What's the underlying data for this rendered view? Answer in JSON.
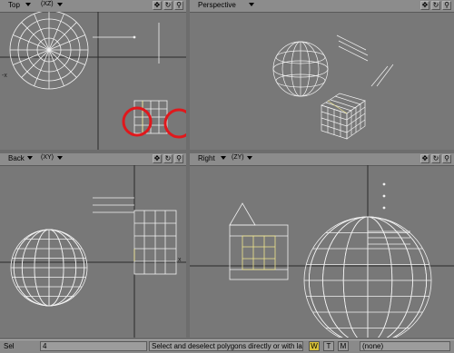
{
  "viewports": {
    "top": {
      "title": "Top",
      "projection": "(XZ)"
    },
    "persp": {
      "title": "Perspective",
      "projection": ""
    },
    "back": {
      "title": "Back",
      "projection": "(XY)"
    },
    "right": {
      "title": "Right",
      "projection": "(ZY)"
    }
  },
  "toolbar_icons": [
    "move-icon",
    "rotate-icon",
    "zoom-icon"
  ],
  "status_bar": {
    "sel_label": "Sel",
    "sel_count": "4",
    "hint": "Select and deselect polygons directly or with las...",
    "w_button": "W",
    "t_button": "T",
    "m_button": "M",
    "layer_value": "(none)"
  },
  "colors": {
    "wire": "#f2f2f2",
    "selected": "#f0e68c",
    "highlight": "#e0181c",
    "viewport_bg": "#787878"
  }
}
